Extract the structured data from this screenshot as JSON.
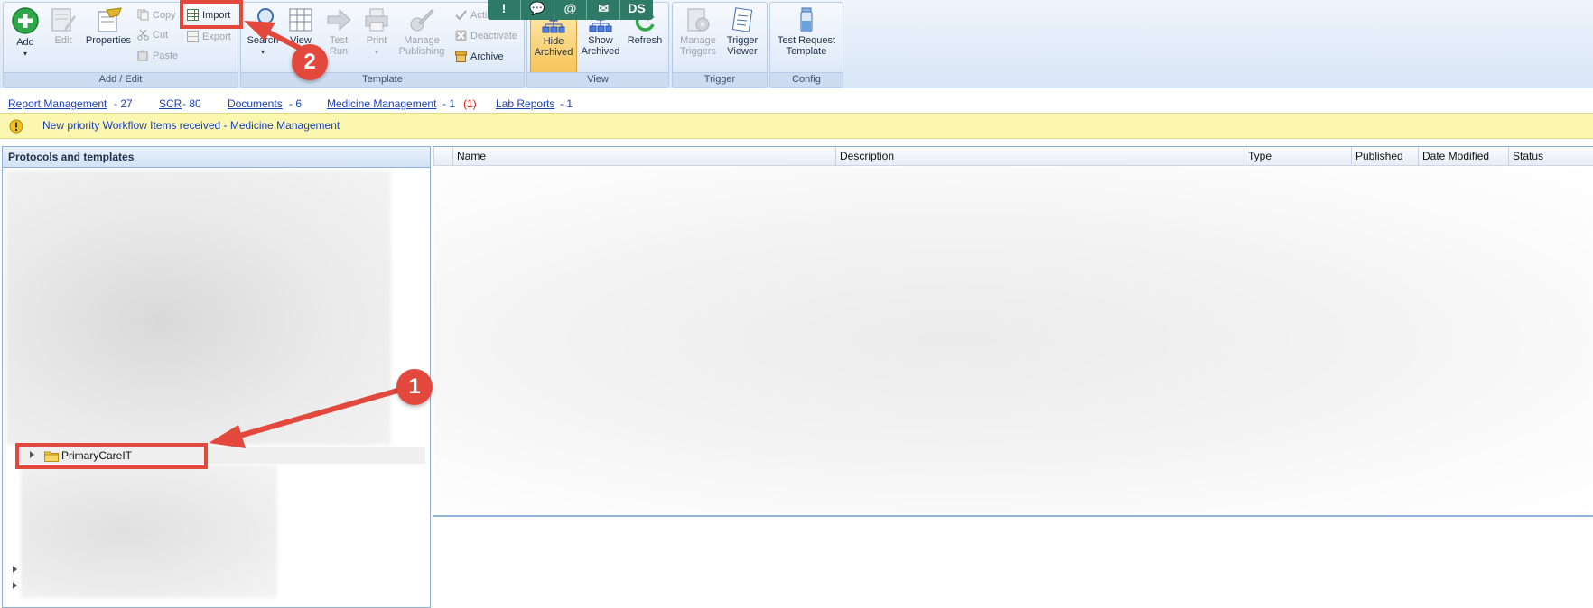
{
  "ribbon": {
    "groups": {
      "add_edit": "Add / Edit",
      "template": "Template",
      "view": "View",
      "trigger": "Trigger",
      "config": "Config"
    },
    "add": "Add",
    "edit": "Edit",
    "properties": "Properties",
    "copy": "Copy",
    "cut": "Cut",
    "paste": "Paste",
    "import": "Import",
    "export": "Export",
    "search": "Search",
    "view_partial": "View",
    "test_run": [
      "Test",
      "Run"
    ],
    "print": "Print",
    "manage_publishing": [
      "Manage",
      "Publishing"
    ],
    "activate": "Acti",
    "deactivate": "Deactivate",
    "archive": "Archive",
    "hide_archived": [
      "Hide",
      "Archived"
    ],
    "show_archived": [
      "Show",
      "Archived"
    ],
    "refresh": "Refresh",
    "manage_triggers": [
      "Manage",
      "Triggers"
    ],
    "trigger_viewer": [
      "Trigger",
      "Viewer"
    ],
    "test_request_template": [
      "Test Request",
      "Template"
    ]
  },
  "chatbar": [
    "!",
    "💬",
    "@",
    "✉",
    "DS"
  ],
  "doclinks": [
    {
      "label": "Report Management",
      "count": "- 27"
    },
    {
      "label": "SCR",
      "count": "- 80"
    },
    {
      "label": "Documents",
      "count": "- 6"
    },
    {
      "label": "Medicine Management",
      "count": "- 1",
      "extra": "(1)"
    },
    {
      "label": "Lab Reports",
      "count": "- 1"
    }
  ],
  "alert": "New priority Workflow Items received - Medicine Management",
  "left_pane": {
    "title": "Protocols and templates",
    "tree_item": "PrimaryCareIT"
  },
  "grid": {
    "columns": [
      "Name",
      "Description",
      "Type",
      "Published",
      "Date Modified",
      "Status"
    ]
  },
  "annotations": {
    "step1": "1",
    "step2": "2"
  },
  "colors": {
    "annotation": "#e2483b",
    "link": "#1a3fb8",
    "alert_bg": "#fbf7b0",
    "ribbon_bg": "#e3edf9"
  }
}
